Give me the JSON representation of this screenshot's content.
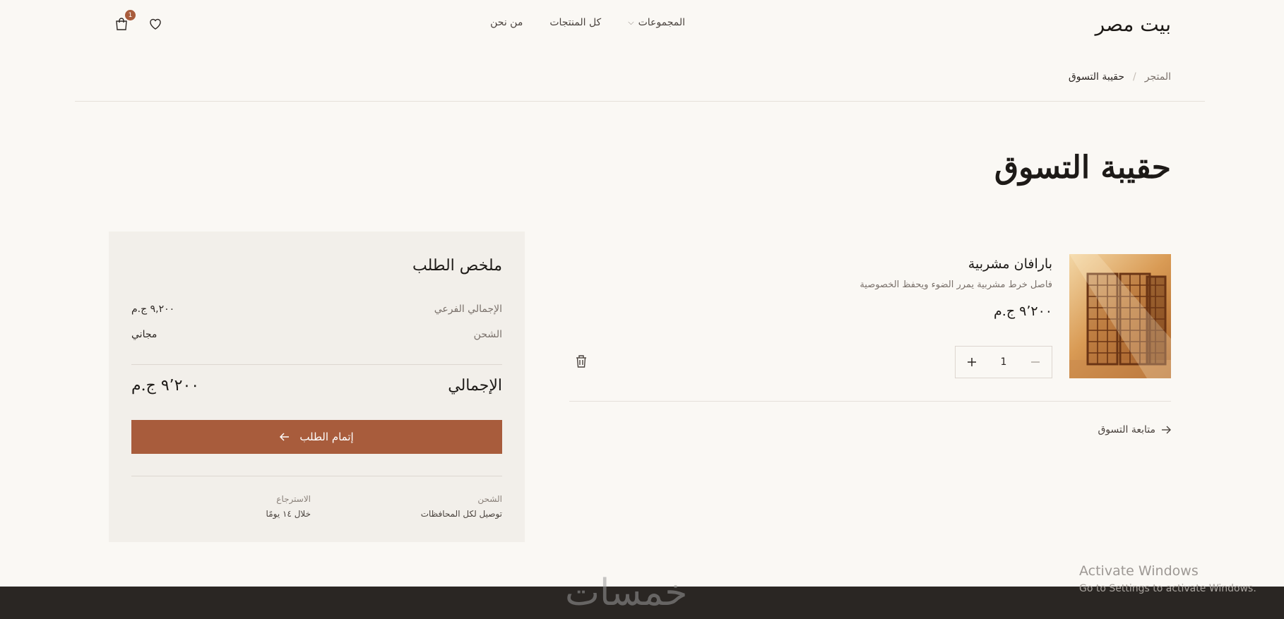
{
  "header": {
    "logo": "بيت مصر",
    "nav": [
      {
        "label": "المجموعات"
      },
      {
        "label": "كل المنتجات"
      },
      {
        "label": "من نحن"
      }
    ],
    "cart_count": "1"
  },
  "breadcrumb": {
    "home": "المتجر",
    "separator": "/",
    "current": "حقيبة التسوق"
  },
  "page_title": "حقيبة التسوق",
  "item": {
    "name": "بارافان مشربية",
    "description": "فاصل خرط مشربية يمرر الضوء ويحفظ الخصوصية",
    "price": "٩٬٢٠٠ ج.م",
    "quantity": "1"
  },
  "continue_shopping": "متابعة التسوق",
  "summary": {
    "title": "ملخص الطلب",
    "subtotal_label": "الإجمالي الفرعي",
    "subtotal_value": "٩,٢٠٠ ج.م",
    "shipping_label": "الشحن",
    "shipping_value": "مجاني",
    "total_label": "الإجمالي",
    "total_value": "٩٬٢٠٠ ج.م",
    "checkout_label": "إتمام الطلب",
    "info": [
      {
        "title": "الشحن",
        "text": "توصيل لكل المحافظات"
      },
      {
        "title": "الاسترجاع",
        "text": "خلال ١٤ يومًا"
      }
    ]
  },
  "footer": {
    "watermark": "خمسات"
  },
  "os_overlay": {
    "line1": "Activate Windows",
    "line2": "Go to Settings to activate Windows."
  },
  "colors": {
    "background": "#faf8f4",
    "accent": "#a85c3c",
    "summary_bg": "#f2efea",
    "footer_bg": "#2a2623"
  }
}
